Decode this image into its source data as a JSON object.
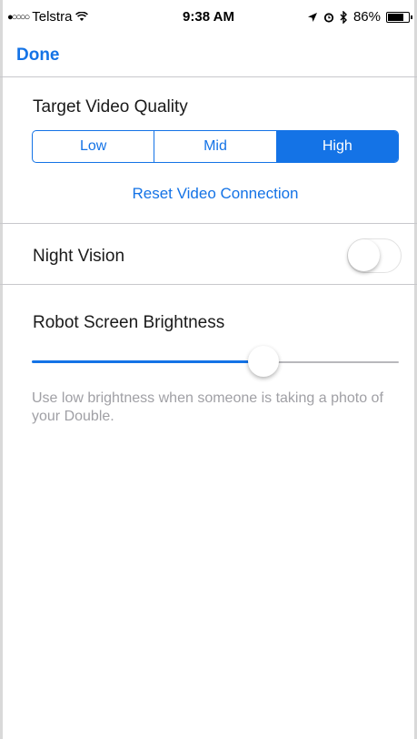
{
  "status_bar": {
    "signal": "●○○○○",
    "carrier": "Telstra",
    "wifi_icon": "wifi-icon",
    "time": "9:38 AM",
    "battery_percent": "86%",
    "battery_level": 0.86
  },
  "nav": {
    "done_label": "Done"
  },
  "video_quality": {
    "title": "Target Video Quality",
    "options": [
      "Low",
      "Mid",
      "High"
    ],
    "selected": "High",
    "reset_label": "Reset Video Connection"
  },
  "night_vision": {
    "label": "Night Vision",
    "enabled": false
  },
  "brightness": {
    "title": "Robot Screen Brightness",
    "value": 0.63,
    "hint": "Use low brightness when someone is taking a photo of your Double."
  },
  "colors": {
    "accent": "#1473e6",
    "hint_text": "#a0a0a5",
    "divider": "#c8c8cc"
  }
}
